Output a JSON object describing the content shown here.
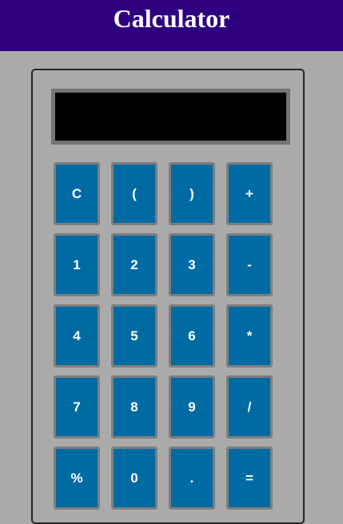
{
  "header": {
    "title": "Calculator"
  },
  "display": {
    "value": ""
  },
  "keys": [
    [
      "C",
      "(",
      ")",
      "+"
    ],
    [
      "1",
      "2",
      "3",
      "-"
    ],
    [
      "4",
      "5",
      "6",
      "*"
    ],
    [
      "7",
      "8",
      "9",
      "/"
    ],
    [
      "%",
      "0",
      ".",
      "="
    ]
  ],
  "colors": {
    "header_bg": "#2e0080",
    "page_bg": "#aaaaaa",
    "key_bg": "#006ba3",
    "display_bg": "#000000"
  }
}
